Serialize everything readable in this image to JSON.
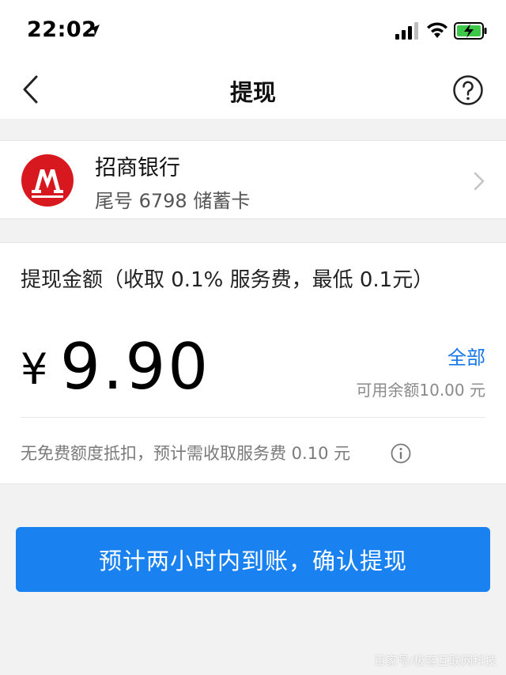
{
  "status_bar": {
    "time": "22:02"
  },
  "nav": {
    "title": "提现"
  },
  "bank": {
    "name": "招商银行",
    "card_info": "尾号 6798 储蓄卡"
  },
  "withdraw": {
    "label": "提现金额（收取 0.1% 服务费，最低 0.1元）",
    "currency": "¥",
    "amount": "9.90",
    "all_label": "全部",
    "available_balance": "可用余额10.00 元",
    "fee_note": "无免费额度抵扣，预计需收取服务费 0.10 元"
  },
  "confirm": {
    "label": "预计两小时内到账，确认提现"
  },
  "watermark": "百家号/极客互联网科技",
  "colors": {
    "accent": "#1a82f0",
    "link": "#1677e8",
    "bank_red": "#d7181e",
    "battery_green": "#3dc84a"
  }
}
